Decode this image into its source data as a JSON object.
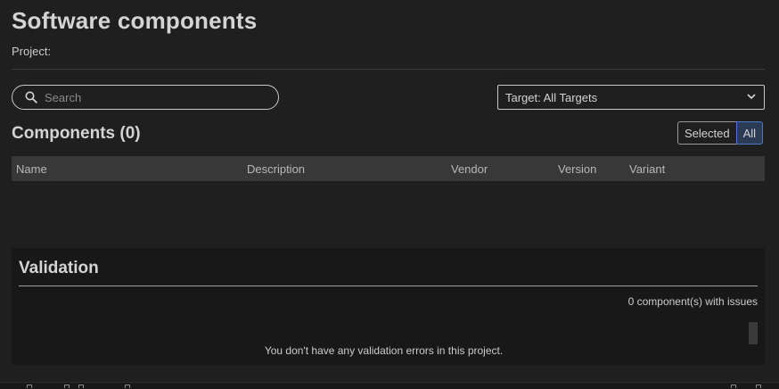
{
  "header": {
    "title": "Software components",
    "project_label": "Project:"
  },
  "toolbar": {
    "search_placeholder": "Search",
    "search_icon": "search-icon",
    "target_select_value": "Target: All Targets",
    "target_chevron_icon": "chevron-down-icon"
  },
  "components": {
    "heading": "Components (0)",
    "filter": {
      "selected_label": "Selected",
      "all_label": "All",
      "active": "All"
    },
    "columns": [
      "Name",
      "Description",
      "Vendor",
      "Version",
      "Variant"
    ],
    "rows": []
  },
  "validation": {
    "heading": "Validation",
    "issues_count_text": "0 component(s) with issues",
    "empty_message": "You don't have any validation errors in this project."
  },
  "colors": {
    "background": "#1f1f1f",
    "table_header_bg": "#383838",
    "validation_bg": "#181818",
    "active_toggle_border": "#4a78c8"
  }
}
